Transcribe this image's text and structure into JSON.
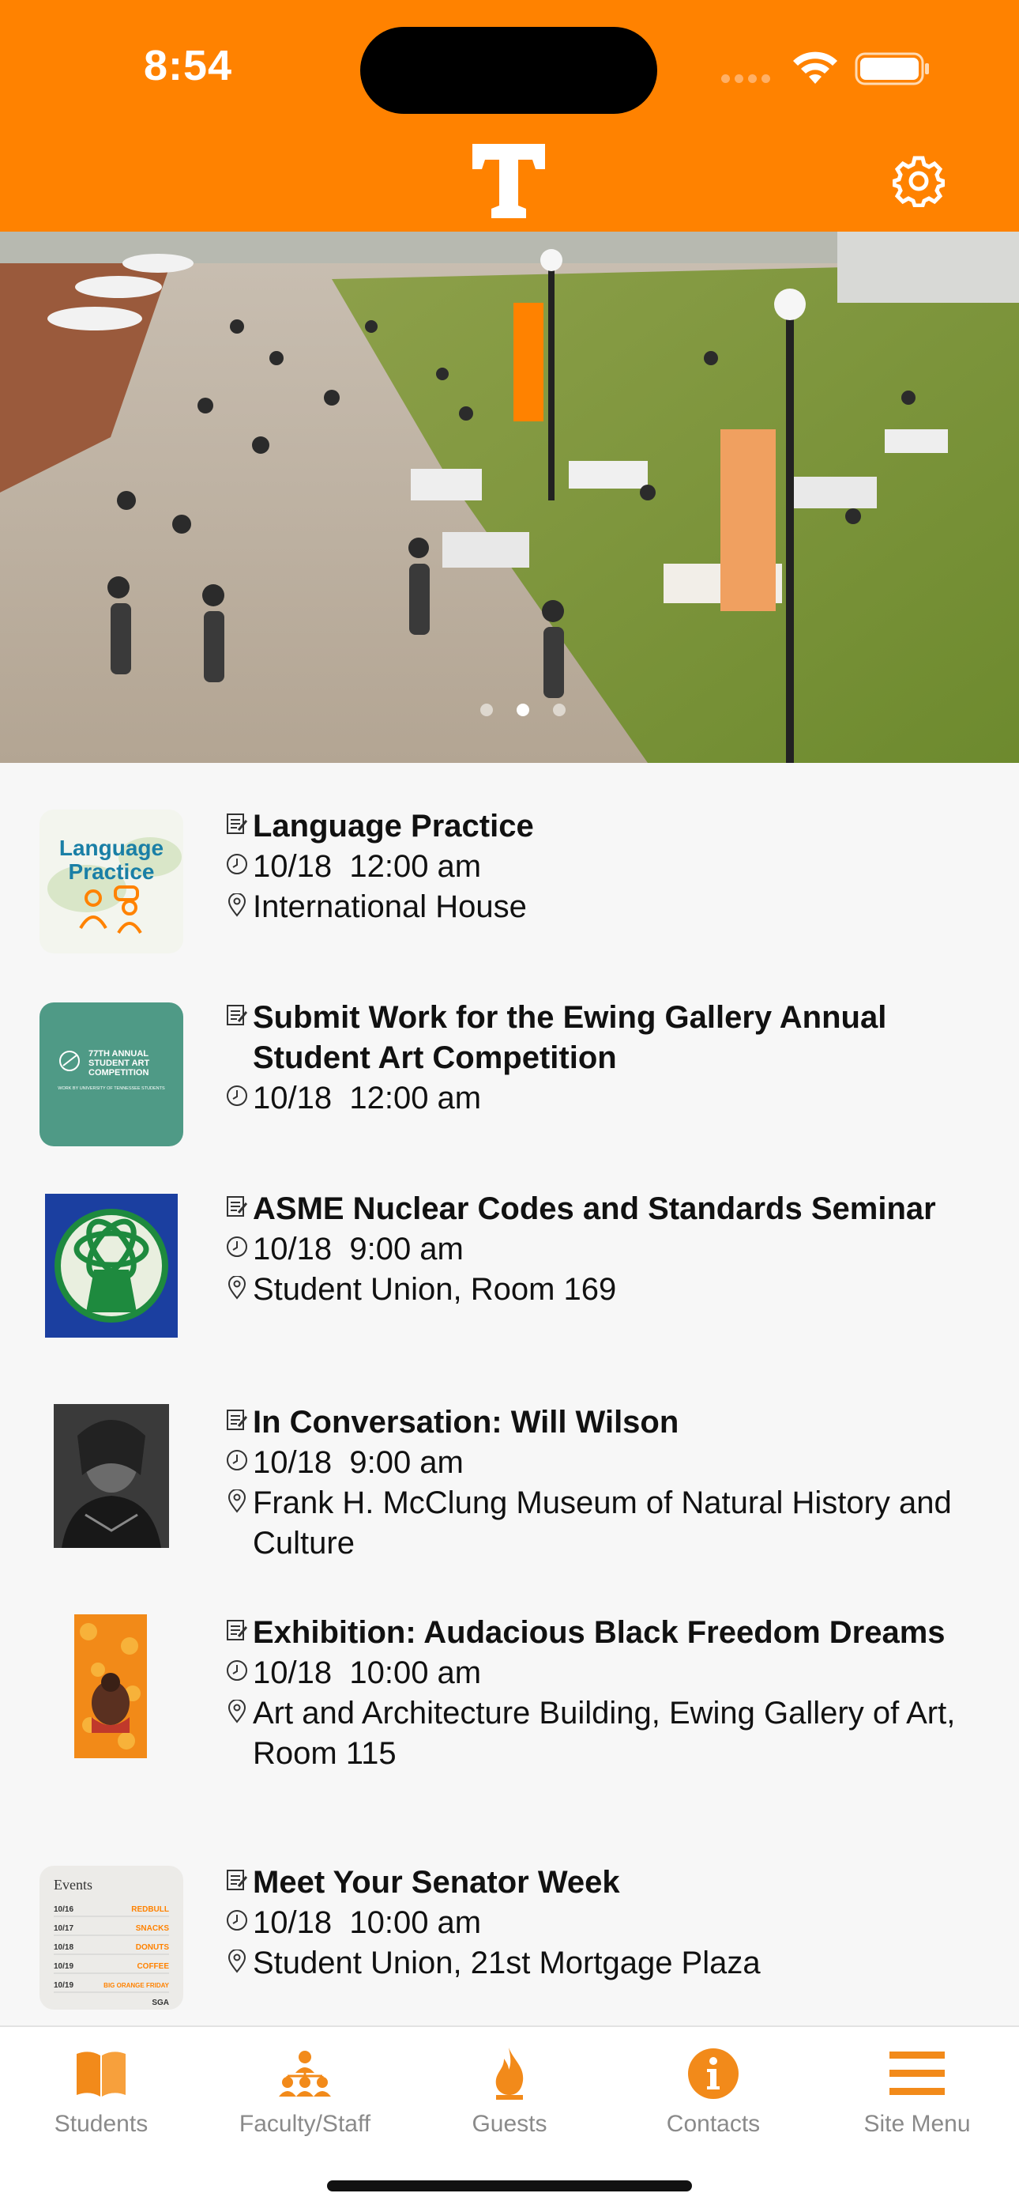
{
  "status_bar": {
    "time": "8:54"
  },
  "header": {
    "logo": "tennessee-t-logo",
    "settings_icon": "gear-icon",
    "color": "#ff8200"
  },
  "hero": {
    "image": "campus-pedestrian-walkway-photo",
    "page_count": 3,
    "active_page": 2
  },
  "events": [
    {
      "title": "Language Practice",
      "date": "10/18",
      "time": "12:00 am",
      "location": "International House",
      "thumb": {
        "line1": "Language",
        "line2": "Practice"
      }
    },
    {
      "title": "Submit Work for the Ewing Gallery Annual Student Art Competition",
      "date": "10/18",
      "time": "12:00 am",
      "location": "",
      "thumb": {
        "line1": "77TH ANNUAL",
        "line2": "STUDENT ART",
        "line3": "COMPETITION",
        "line4": "WORK BY UNIVERSITY OF TENNESSEE STUDENTS"
      }
    },
    {
      "title": "ASME Nuclear Codes and Standards Seminar",
      "date": "10/18",
      "time": "9:00 am",
      "location": "Student Union, Room 169"
    },
    {
      "title": "In Conversation: Will Wilson",
      "date": "10/18",
      "time": "9:00 am",
      "location": "Frank H. McClung Museum of Natural History and Culture"
    },
    {
      "title": "Exhibition: Audacious Black Freedom Dreams",
      "date": "10/18",
      "time": "10:00 am",
      "location": "Art and Architecture Building, Ewing Gallery of Art, Room 115"
    },
    {
      "title": "Meet Your Senator Week",
      "date": "10/18",
      "time": "10:00 am",
      "location": "Student Union, 21st Mortgage Plaza",
      "thumb": {
        "heading": "Events",
        "rows": [
          {
            "date": "10/16",
            "item": "REDBULL"
          },
          {
            "date": "10/17",
            "item": "SNACKS"
          },
          {
            "date": "10/18",
            "item": "DONUTS"
          },
          {
            "date": "10/19",
            "item": "COFFEE"
          },
          {
            "date": "10/19",
            "item": "BIG ORANGE FRIDAY"
          }
        ],
        "footer": "SGA"
      }
    }
  ],
  "tabbar": {
    "tabs": [
      {
        "label": "Students",
        "icon": "book-icon"
      },
      {
        "label": "Faculty/Staff",
        "icon": "org-chart-icon"
      },
      {
        "label": "Guests",
        "icon": "flame-icon"
      },
      {
        "label": "Contacts",
        "icon": "info-icon"
      },
      {
        "label": "Site Menu",
        "icon": "hamburger-menu-icon"
      }
    ]
  }
}
